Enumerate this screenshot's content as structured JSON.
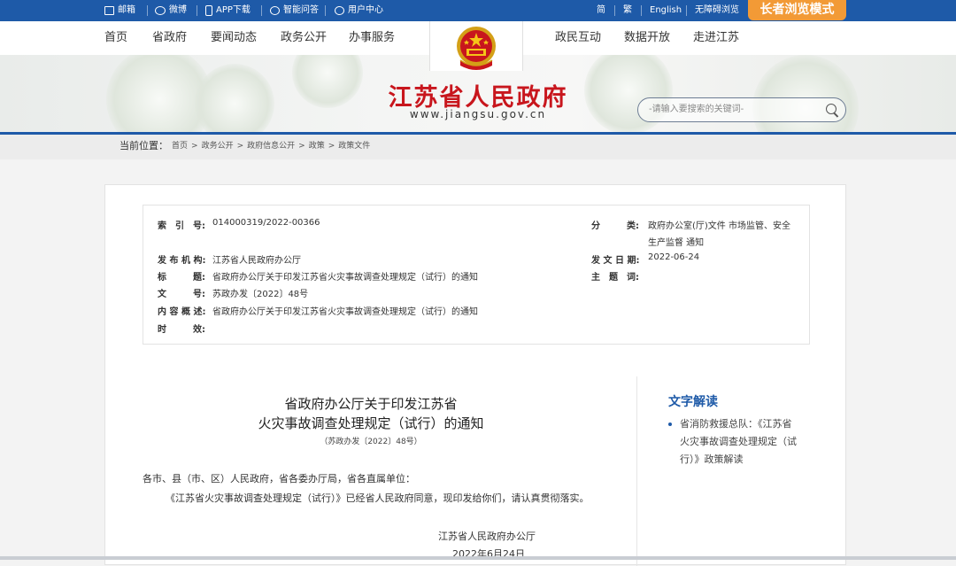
{
  "topbar": {
    "items": [
      "邮箱",
      "微博",
      "APP下载",
      "智能问答",
      "用户中心"
    ],
    "lang": [
      "简",
      "繁",
      "English",
      "无障碍浏览"
    ],
    "elder_mode": "长者浏览模式"
  },
  "nav": {
    "left": [
      "首页",
      "省政府",
      "要闻动态",
      "政务公开",
      "办事服务"
    ],
    "right": [
      "政民互动",
      "数据开放",
      "走进江苏"
    ]
  },
  "banner": {
    "title": "江苏省人民政府",
    "url": "www.jiangsu.gov.cn",
    "search_placeholder": "-请输入要搜索的关键词-"
  },
  "breadcrumb": {
    "label": "当前位置：",
    "path": [
      "首页",
      "政务公开",
      "政府信息公开",
      "政策",
      "政策文件"
    ],
    "separator": ">"
  },
  "meta": {
    "index_label": "索　引　号:",
    "index_value": "014000319/2022-00366",
    "category_label": "分　　　类:",
    "category_value_1": "政府办公室(厅)文件 市场监管、安全",
    "category_value_2": "生产监督 通知",
    "publisher_label": "发 布 机 构:",
    "publisher_value": "江苏省人民政府办公厅",
    "date_label": "发 文 日 期:",
    "date_value": "2022-06-24",
    "title_label": "标　　　题:",
    "title_value": "省政府办公厅关于印发江苏省火灾事故调查处理规定（试行）的通知",
    "subject_label": "主　题　词:",
    "subject_value": "",
    "docno_label": "文　　　号:",
    "docno_value": "苏政办发〔2022〕48号",
    "summary_label": "内 容 概 述:",
    "summary_value": "省政府办公厅关于印发江苏省火灾事故调查处理规定（试行）的通知",
    "validity_label": "时　　　效:",
    "validity_value": ""
  },
  "document": {
    "title_line1": "省政府办公厅关于印发江苏省",
    "title_line2": "火灾事故调查处理规定（试行）的通知",
    "doc_number": "（苏政办发〔2022〕48号）",
    "salutation": "各市、县（市、区）人民政府，省各委办厅局，省各直属单位：",
    "body": "《江苏省火灾事故调查处理规定（试行）》已经省人民政府同意，现印发给你们，请认真贯彻落实。",
    "signature": "江苏省人民政府办公厅",
    "sign_date": "2022年6月24日"
  },
  "sidebar": {
    "title": "文字解读",
    "item_line1": "省消防救援总队：《江苏省",
    "item_line2": "火灾事故调查处理规定（试",
    "item_line3": "行）》政策解读"
  },
  "colors": {
    "primary": "#1e5aa8",
    "accent": "#f29a36",
    "title_red": "#c8161d"
  }
}
